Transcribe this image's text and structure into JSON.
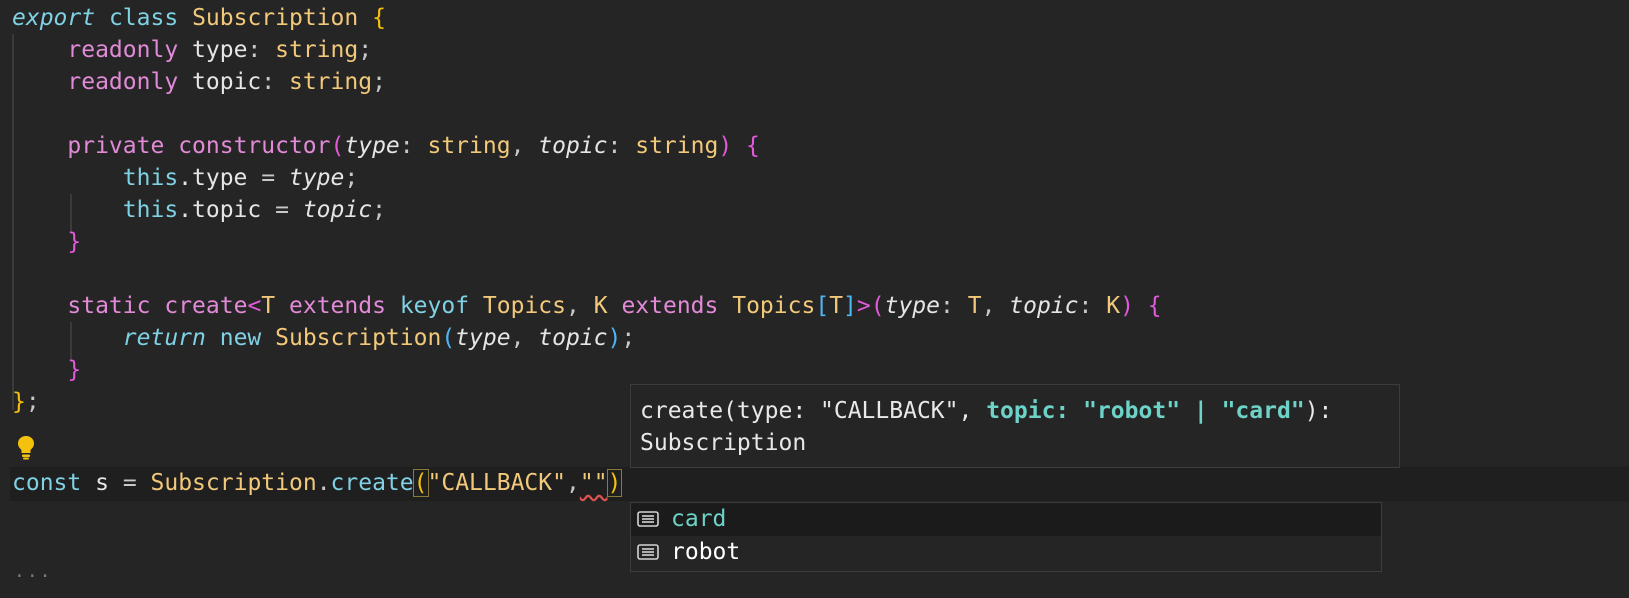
{
  "editor": {
    "lines": {
      "l1": {
        "export": "export",
        "class": "class",
        "name": "Subscription",
        "brace": "{"
      },
      "l2": {
        "readonly": "readonly",
        "prop": "type",
        "colon": ": ",
        "type": "string",
        "semi": ";"
      },
      "l3": {
        "readonly": "readonly",
        "prop": "topic",
        "colon": ": ",
        "type": "string",
        "semi": ";"
      },
      "l5": {
        "private": "private",
        "ctor": "constructor",
        "p1": "type",
        "t1": "string",
        "p2": "topic",
        "t2": "string"
      },
      "l6": {
        "this": "this",
        "prop": ".type",
        "eq": " = ",
        "param": "type",
        "semi": ";"
      },
      "l7": {
        "this": "this",
        "prop": ".topic",
        "eq": " = ",
        "param": "topic",
        "semi": ";"
      },
      "l8": {
        "brace": "}"
      },
      "l10": {
        "static": "static",
        "fn": "create",
        "T": "T",
        "extends1": "extends",
        "keyof": "keyof",
        "topics1": "Topics",
        "K": "K",
        "extends2": "extends",
        "topics2": "Topics",
        "Tidx": "T",
        "p1": "type",
        "p1t": "T",
        "p2": "topic",
        "p2t": "K"
      },
      "l11": {
        "return": "return",
        "new": "new",
        "cls": "Subscription",
        "p1": "type",
        "p2": "topic"
      },
      "l12": {
        "brace": "}"
      },
      "l13": {
        "end": "}",
        "semi": ";"
      },
      "l15": {
        "const": "const",
        "var": "s",
        "eq": " = ",
        "cls": "Subscription",
        "fn": "create",
        "arg1": "\"CALLBACK\"",
        "comma": ",",
        "arg2": "\"\""
      }
    },
    "ellipsis": "···"
  },
  "signature_help": {
    "prefix": "create(type: \"CALLBACK\", ",
    "active_param": "topic: \"robot\" | \"card\"",
    "suffix": "):",
    "return_line": "Subscription"
  },
  "suggestions": [
    {
      "label": "card",
      "icon": "text-icon",
      "selected": true
    },
    {
      "label": "robot",
      "icon": "text-icon",
      "selected": false
    }
  ],
  "colors": {
    "background": "#252526",
    "keyword": "#e28ad7",
    "type": "#f2c879",
    "accent": "#6ed3c7"
  }
}
